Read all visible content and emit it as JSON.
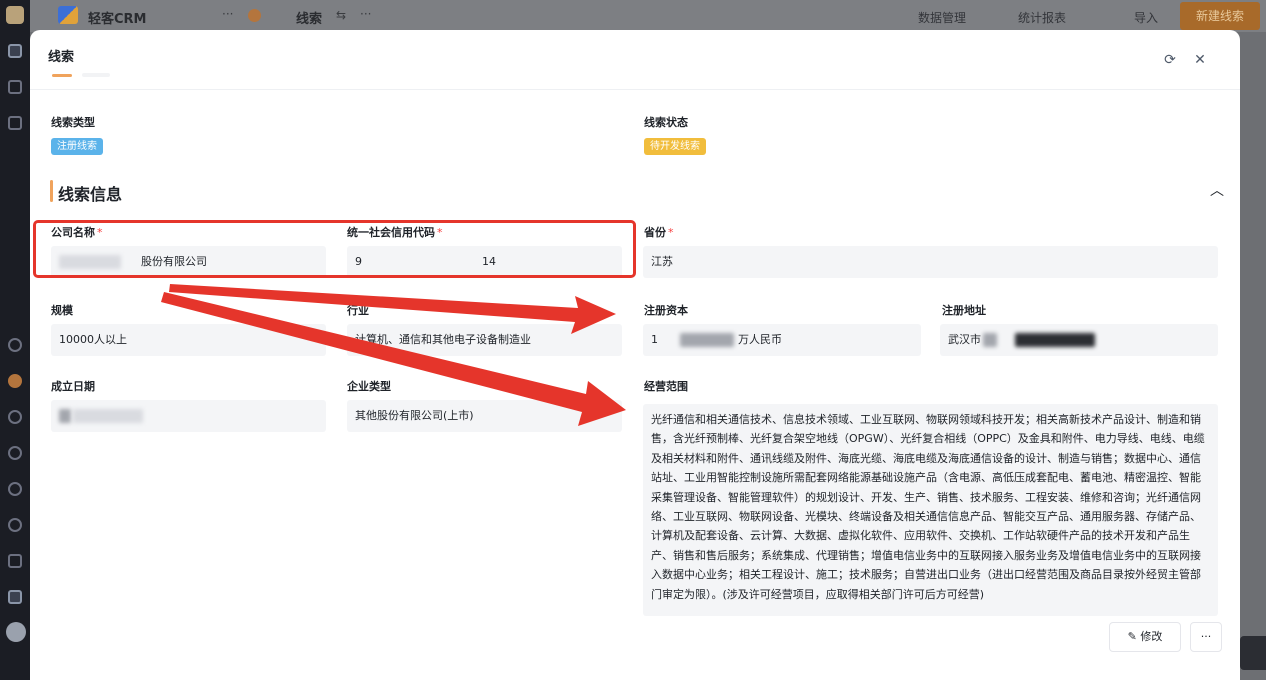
{
  "app": {
    "brand": "轻客CRM",
    "module": "线索",
    "top_links": [
      "数据管理",
      "统计报表",
      "导入"
    ],
    "new_button": "新建线索"
  },
  "modal": {
    "title": "线索",
    "clue_type_label": "线索类型",
    "clue_type_value": "注册线索",
    "clue_status_label": "线索状态",
    "clue_status_value": "待开发线索",
    "section_title": "线索信息",
    "fields": {
      "company_name": {
        "label": "公司名称",
        "value": "股份有限公司"
      },
      "credit_code": {
        "label": "统一社会信用代码",
        "value_start": "9",
        "value_end": "14"
      },
      "province": {
        "label": "省份",
        "value": "江苏"
      },
      "scale": {
        "label": "规模",
        "value": "10000人以上"
      },
      "industry": {
        "label": "行业",
        "value": "计算机、通信和其他电子设备制造业"
      },
      "registered_capital": {
        "label": "注册资本",
        "value_start": "1",
        "value_end": "万人民币"
      },
      "registered_address": {
        "label": "注册地址",
        "value": "武汉市"
      },
      "founded_date": {
        "label": "成立日期",
        "value_end": ""
      },
      "company_type": {
        "label": "企业类型",
        "value": "其他股份有限公司(上市)"
      },
      "business_scope": {
        "label": "经营范围",
        "value": "光纤通信和相关通信技术、信息技术领域、工业互联网、物联网领域科技开发；相关高新技术产品设计、制造和销售，含光纤预制棒、光纤复合架空地线（OPGW）、光纤复合相线（OPPC）及金具和附件、电力导线、电线、电缆及相关材料和附件、通讯线缆及附件、海底光缆、海底电缆及海底通信设备的设计、制造与销售；数据中心、通信站址、工业用智能控制设施所需配套网络能源基础设施产品（含电源、高低压成套配电、蓄电池、精密温控、智能采集管理设备、智能管理软件）的规划设计、开发、生产、销售、技术服务、工程安装、维修和咨询；光纤通信网络、工业互联网、物联网设备、光模块、终端设备及相关通信信息产品、智能交互产品、通用服务器、存储产品、计算机及配套设备、云计算、大数据、虚拟化软件、应用软件、交换机、工作站软硬件产品的技术开发和产品生产、销售和售后服务；系统集成、代理销售；增值电信业务中的互联网接入服务业务及增值电信业务中的互联网接入数据中心业务；相关工程设计、施工；技术服务；自营进出口业务（进出口经营范围及商品目录按外经贸主管部门审定为限）。(涉及许可经营项目，应取得相关部门许可后方可经营)"
      }
    },
    "edit_button": "修改",
    "more_button": "···"
  },
  "icons": {
    "refresh": "refresh-icon",
    "close": "close-icon",
    "collapse": "chevron-up-icon",
    "edit": "edit-icon"
  },
  "colors": {
    "accent": "#f0a35c",
    "highlight_red": "#e5352b",
    "tag_blue": "#5bb3ea",
    "tag_yellow": "#f1bd3c",
    "required": "#f53f3f"
  }
}
